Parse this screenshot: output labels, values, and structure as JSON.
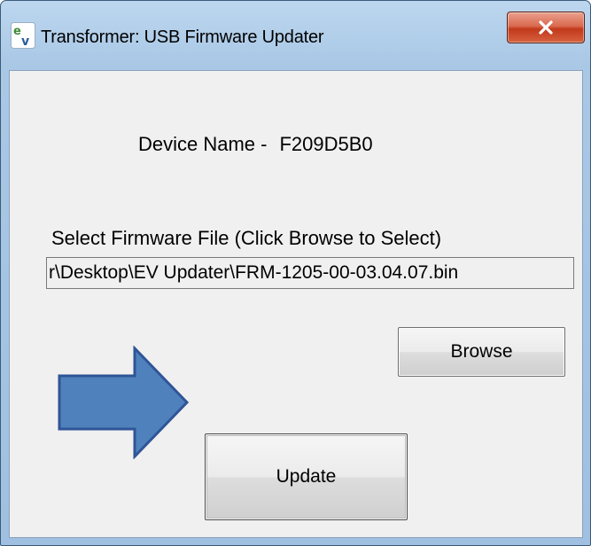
{
  "window": {
    "title": "Transformer: USB Firmware Updater",
    "close_icon": "close-x-icon",
    "app_icon": "ev-logo-icon"
  },
  "device": {
    "label": "Device Name -",
    "value": "F209D5B0"
  },
  "firmware": {
    "select_label": "Select Firmware File (Click Browse to Select)",
    "path_value": "r\\Desktop\\EV Updater\\FRM-1205-00-03.04.07.bin"
  },
  "buttons": {
    "browse_label": "Browse",
    "update_label": "Update"
  },
  "annotation": {
    "icon": "right-arrow-icon",
    "color": "#4f81bd",
    "border_color": "#2f5597"
  },
  "colors": {
    "close_button": "#c2391c",
    "frame": "#a9c8e6",
    "client_background": "#f0f0f0"
  }
}
